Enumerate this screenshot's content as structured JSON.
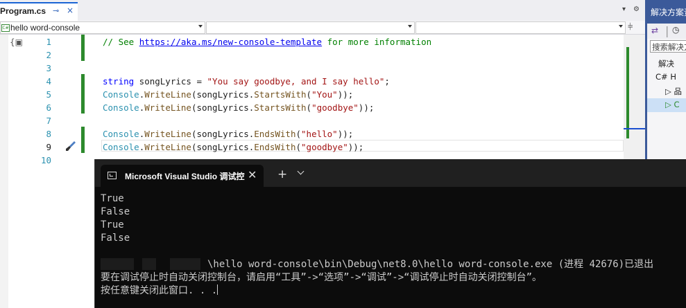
{
  "editor_tab": {
    "title": "Program.cs",
    "pin": "⊸",
    "close": "×"
  },
  "tabbar_icons": {
    "dropdown": "▾",
    "settings": "⚙"
  },
  "navbar": {
    "project_dropdown": "hello word-console",
    "project_badge": "C#",
    "type_dropdown": "",
    "member_dropdown": "",
    "split_icon": "split-editor-icon"
  },
  "line_numbers": [
    "1",
    "2",
    "3",
    "4",
    "5",
    "6",
    "7",
    "8",
    "9",
    "10"
  ],
  "code": {
    "line1_comment": "// See ",
    "line1_link": "https://aka.ms/new-console-template",
    "line1_tail": " for more information",
    "line4": {
      "kw": "string",
      "var": " songLyrics = ",
      "str": "\"You say goodbye, and I say hello\"",
      "end": ";"
    },
    "line5": {
      "cls": "Console",
      "dot": ".",
      "fn": "WriteLine",
      "open": "(songLyrics.",
      "fn2": "StartsWith",
      "p": "(",
      "str": "\"You\"",
      "end": "));"
    },
    "line6": {
      "cls": "Console",
      "dot": ".",
      "fn": "WriteLine",
      "open": "(songLyrics.",
      "fn2": "StartsWith",
      "p": "(",
      "str": "\"goodbye\"",
      "end": "));"
    },
    "line8": {
      "cls": "Console",
      "dot": ".",
      "fn": "WriteLine",
      "open": "(songLyrics.",
      "fn2": "EndsWith",
      "p": "(",
      "str": "\"hello\"",
      "end": "));"
    },
    "line9": {
      "cls": "Console",
      "dot": ".",
      "fn": "WriteLine",
      "open": "(songLyrics.",
      "fn2": "EndsWith",
      "p": "(",
      "str": "\"goodbye\"",
      "end": "));"
    }
  },
  "solution_explorer": {
    "title": "解决方案资",
    "search_placeholder": "搜索解决方",
    "rows": [
      "解决",
      "C# H",
      "▷ 品",
      "▷ C"
    ]
  },
  "terminal": {
    "tab_title": "Microsoft Visual Studio 调试控",
    "close": "✕",
    "plus": "+",
    "output": [
      "True",
      "False",
      "True",
      "False"
    ],
    "exit_line": "\\hello word-console\\bin\\Debug\\net8.0\\hello word-console.exe (进程 42676)已退出",
    "hint_line": "要在调试停止时自动关闭控制台，请启用“工具”->“选项”->“调试”->“调试停止时自动关闭控制台”。",
    "press_key_line": "按任意键关闭此窗口. . ."
  },
  "colors": {
    "accent": "#1a64d4",
    "changebar": "#2d8a2d",
    "solution_title": "#3b5a9a",
    "terminal_bg": "#0c0c0c"
  }
}
